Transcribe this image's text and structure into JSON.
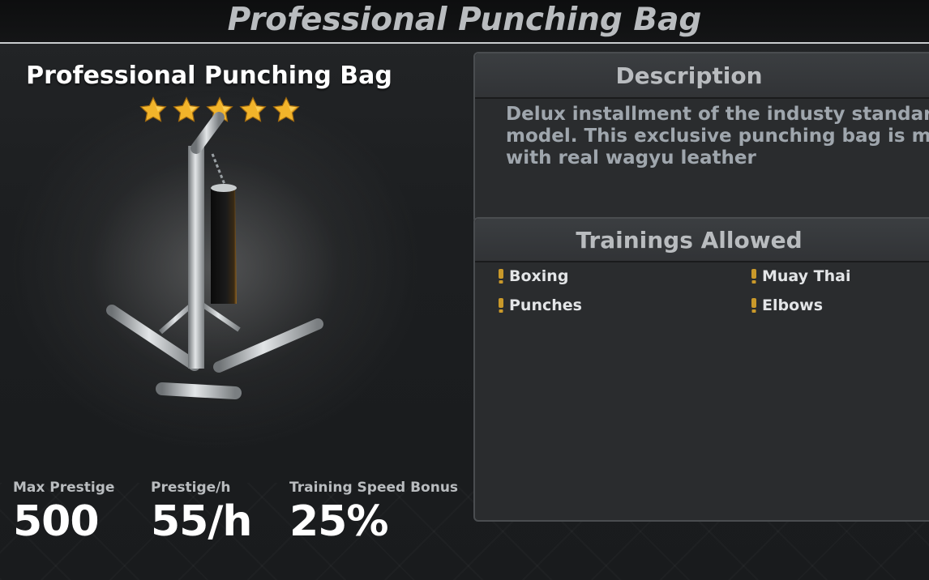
{
  "header": {
    "title": "Professional Punching Bag"
  },
  "item": {
    "name": "Professional Punching Bag",
    "rating": 5,
    "rating_max": 5,
    "image_icon": "punching-bag-stand"
  },
  "stats": [
    {
      "label": "Max Prestige",
      "value": "500"
    },
    {
      "label": "Prestige/h",
      "value": "55/h"
    },
    {
      "label": "Training Speed Bonus",
      "value": "25%"
    }
  ],
  "description": {
    "heading": "Description",
    "lines": [
      "Delux installment of the industy standard",
      "model. This exclusive punching bag is made",
      "with real wagyu leather"
    ]
  },
  "trainings": {
    "heading": "Trainings Allowed",
    "items": [
      "Boxing",
      "Muay Thai",
      "Punches",
      "Elbows"
    ],
    "bullet_icon": "gold-bullet-icon"
  },
  "colors": {
    "star": "#f2b42a",
    "bullet": "#c9992a",
    "label_gray": "#b9bcbf",
    "desc_text": "#9fa6ad"
  }
}
